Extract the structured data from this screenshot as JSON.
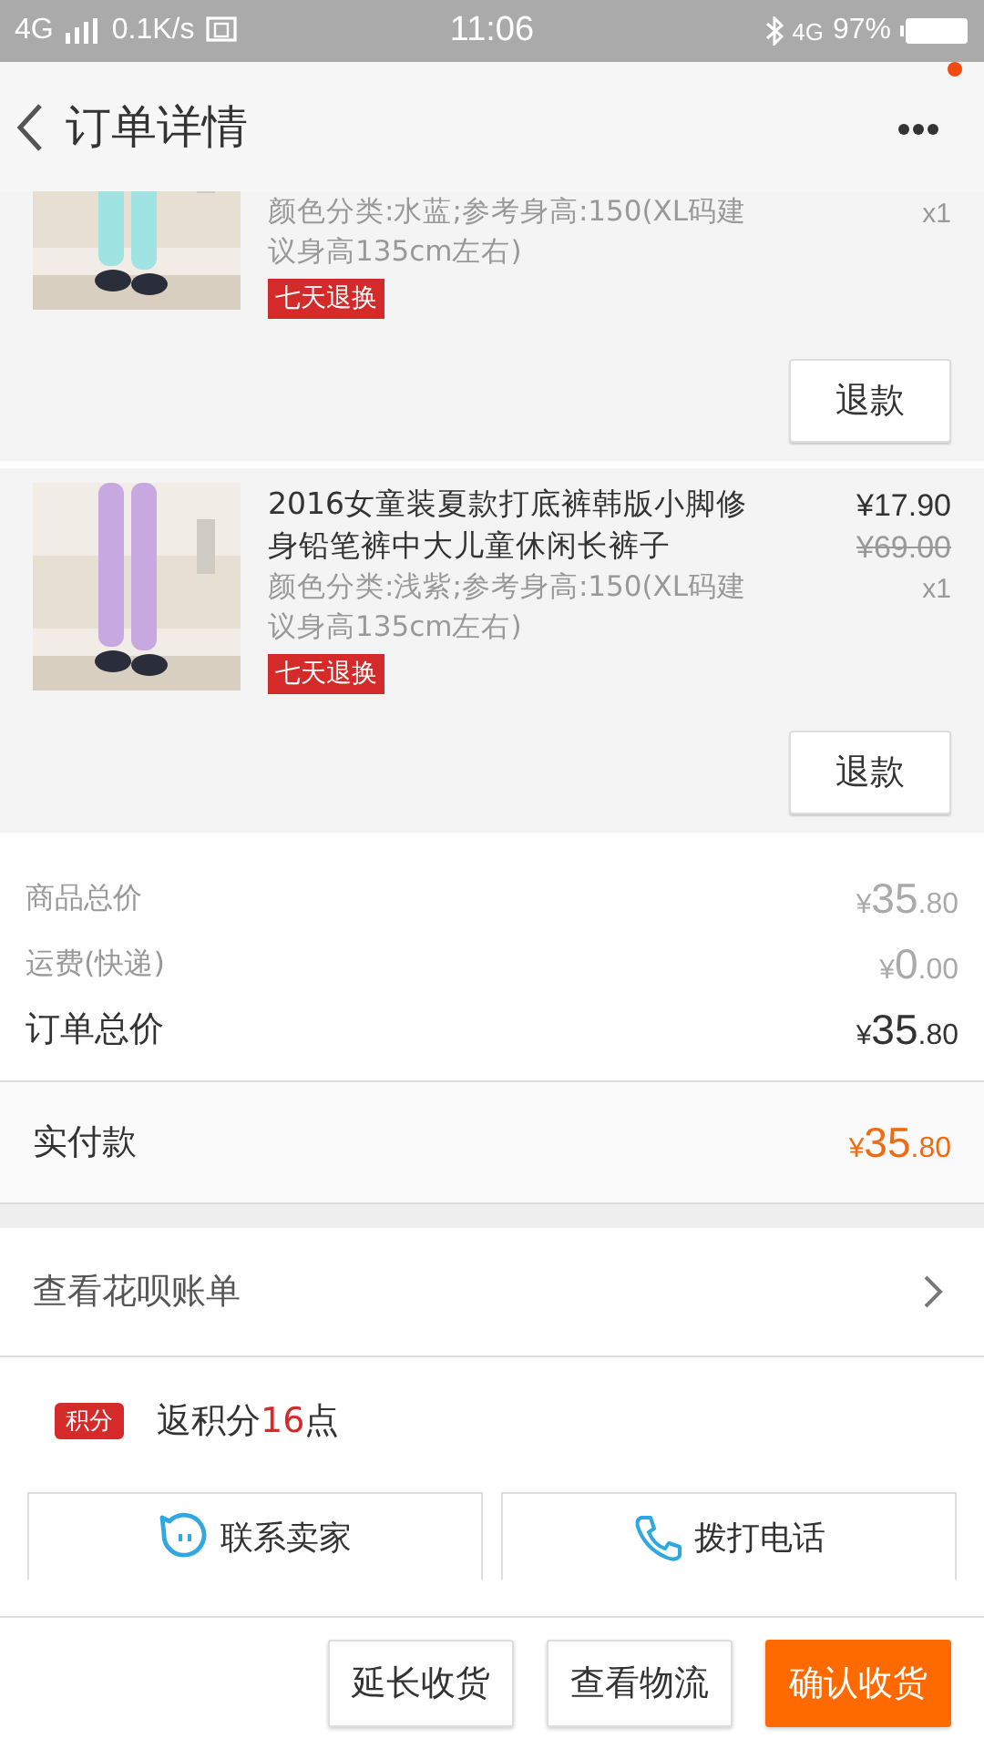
{
  "status_bar": {
    "network": "4G",
    "speed": "0.1K/s",
    "time": "11:06",
    "network_right": "4G",
    "battery": "97%"
  },
  "header": {
    "title": "订单详情",
    "has_notification": true
  },
  "items": [
    {
      "kind": "partial",
      "spec": "颜色分类:水蓝;参考身高:150(XL码建议身高135cm左右)",
      "quantity": "x1",
      "badge": "七天退换",
      "refund": "退款"
    },
    {
      "kind": "full",
      "title": "2016女童装夏款打底裤韩版小脚修身铅笔裤中大儿童休闲长裤子",
      "price": "¥17.90",
      "original_price": "¥69.00",
      "spec": "颜色分类:浅紫;参考身高:150(XL码建议身高135cm左右)",
      "quantity": "x1",
      "badge": "七天退换",
      "refund": "退款"
    }
  ],
  "summary": [
    {
      "kind": "minor",
      "label": "商品总价",
      "currency": "¥",
      "integer": "35",
      "decimal": ".80"
    },
    {
      "kind": "minor",
      "label": "运费(快递)",
      "currency": "¥",
      "integer": "0",
      "decimal": ".00"
    },
    {
      "kind": "total",
      "label": "订单总价",
      "currency": "¥",
      "integer": "35",
      "decimal": ".80"
    }
  ],
  "paid": {
    "label": "实付款",
    "currency": "¥",
    "integer": "35",
    "decimal": ".80"
  },
  "huabei": {
    "label": "查看花呗账单"
  },
  "points": {
    "tag": "积分",
    "prefix": "返积分",
    "number": "16",
    "suffix": "点"
  },
  "contact": [
    {
      "kind": "chat",
      "label": "联系卖家"
    },
    {
      "kind": "phone",
      "label": "拨打电话"
    }
  ],
  "actions": [
    {
      "label": "延长收货",
      "primary": false
    },
    {
      "label": "查看物流",
      "primary": false
    },
    {
      "label": "确认收货",
      "primary": true
    }
  ]
}
